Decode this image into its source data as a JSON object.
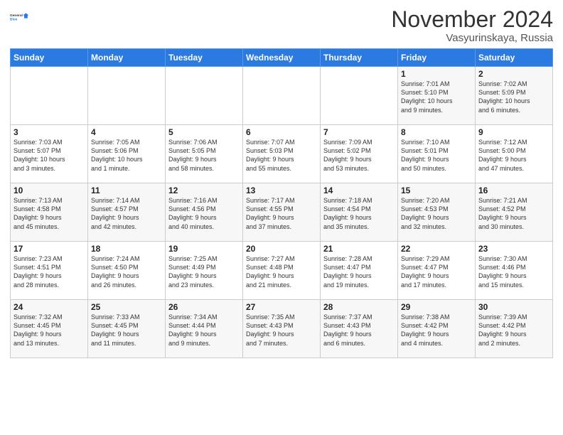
{
  "logo": {
    "line1": "General",
    "line2": "Blue"
  },
  "header": {
    "month": "November 2024",
    "location": "Vasyurinskaya, Russia"
  },
  "weekdays": [
    "Sunday",
    "Monday",
    "Tuesday",
    "Wednesday",
    "Thursday",
    "Friday",
    "Saturday"
  ],
  "weeks": [
    [
      {
        "day": "",
        "info": ""
      },
      {
        "day": "",
        "info": ""
      },
      {
        "day": "",
        "info": ""
      },
      {
        "day": "",
        "info": ""
      },
      {
        "day": "",
        "info": ""
      },
      {
        "day": "1",
        "info": "Sunrise: 7:01 AM\nSunset: 5:10 PM\nDaylight: 10 hours\nand 9 minutes."
      },
      {
        "day": "2",
        "info": "Sunrise: 7:02 AM\nSunset: 5:09 PM\nDaylight: 10 hours\nand 6 minutes."
      }
    ],
    [
      {
        "day": "3",
        "info": "Sunrise: 7:03 AM\nSunset: 5:07 PM\nDaylight: 10 hours\nand 3 minutes."
      },
      {
        "day": "4",
        "info": "Sunrise: 7:05 AM\nSunset: 5:06 PM\nDaylight: 10 hours\nand 1 minute."
      },
      {
        "day": "5",
        "info": "Sunrise: 7:06 AM\nSunset: 5:05 PM\nDaylight: 9 hours\nand 58 minutes."
      },
      {
        "day": "6",
        "info": "Sunrise: 7:07 AM\nSunset: 5:03 PM\nDaylight: 9 hours\nand 55 minutes."
      },
      {
        "day": "7",
        "info": "Sunrise: 7:09 AM\nSunset: 5:02 PM\nDaylight: 9 hours\nand 53 minutes."
      },
      {
        "day": "8",
        "info": "Sunrise: 7:10 AM\nSunset: 5:01 PM\nDaylight: 9 hours\nand 50 minutes."
      },
      {
        "day": "9",
        "info": "Sunrise: 7:12 AM\nSunset: 5:00 PM\nDaylight: 9 hours\nand 47 minutes."
      }
    ],
    [
      {
        "day": "10",
        "info": "Sunrise: 7:13 AM\nSunset: 4:58 PM\nDaylight: 9 hours\nand 45 minutes."
      },
      {
        "day": "11",
        "info": "Sunrise: 7:14 AM\nSunset: 4:57 PM\nDaylight: 9 hours\nand 42 minutes."
      },
      {
        "day": "12",
        "info": "Sunrise: 7:16 AM\nSunset: 4:56 PM\nDaylight: 9 hours\nand 40 minutes."
      },
      {
        "day": "13",
        "info": "Sunrise: 7:17 AM\nSunset: 4:55 PM\nDaylight: 9 hours\nand 37 minutes."
      },
      {
        "day": "14",
        "info": "Sunrise: 7:18 AM\nSunset: 4:54 PM\nDaylight: 9 hours\nand 35 minutes."
      },
      {
        "day": "15",
        "info": "Sunrise: 7:20 AM\nSunset: 4:53 PM\nDaylight: 9 hours\nand 32 minutes."
      },
      {
        "day": "16",
        "info": "Sunrise: 7:21 AM\nSunset: 4:52 PM\nDaylight: 9 hours\nand 30 minutes."
      }
    ],
    [
      {
        "day": "17",
        "info": "Sunrise: 7:23 AM\nSunset: 4:51 PM\nDaylight: 9 hours\nand 28 minutes."
      },
      {
        "day": "18",
        "info": "Sunrise: 7:24 AM\nSunset: 4:50 PM\nDaylight: 9 hours\nand 26 minutes."
      },
      {
        "day": "19",
        "info": "Sunrise: 7:25 AM\nSunset: 4:49 PM\nDaylight: 9 hours\nand 23 minutes."
      },
      {
        "day": "20",
        "info": "Sunrise: 7:27 AM\nSunset: 4:48 PM\nDaylight: 9 hours\nand 21 minutes."
      },
      {
        "day": "21",
        "info": "Sunrise: 7:28 AM\nSunset: 4:47 PM\nDaylight: 9 hours\nand 19 minutes."
      },
      {
        "day": "22",
        "info": "Sunrise: 7:29 AM\nSunset: 4:47 PM\nDaylight: 9 hours\nand 17 minutes."
      },
      {
        "day": "23",
        "info": "Sunrise: 7:30 AM\nSunset: 4:46 PM\nDaylight: 9 hours\nand 15 minutes."
      }
    ],
    [
      {
        "day": "24",
        "info": "Sunrise: 7:32 AM\nSunset: 4:45 PM\nDaylight: 9 hours\nand 13 minutes."
      },
      {
        "day": "25",
        "info": "Sunrise: 7:33 AM\nSunset: 4:45 PM\nDaylight: 9 hours\nand 11 minutes."
      },
      {
        "day": "26",
        "info": "Sunrise: 7:34 AM\nSunset: 4:44 PM\nDaylight: 9 hours\nand 9 minutes."
      },
      {
        "day": "27",
        "info": "Sunrise: 7:35 AM\nSunset: 4:43 PM\nDaylight: 9 hours\nand 7 minutes."
      },
      {
        "day": "28",
        "info": "Sunrise: 7:37 AM\nSunset: 4:43 PM\nDaylight: 9 hours\nand 6 minutes."
      },
      {
        "day": "29",
        "info": "Sunrise: 7:38 AM\nSunset: 4:42 PM\nDaylight: 9 hours\nand 4 minutes."
      },
      {
        "day": "30",
        "info": "Sunrise: 7:39 AM\nSunset: 4:42 PM\nDaylight: 9 hours\nand 2 minutes."
      }
    ]
  ]
}
